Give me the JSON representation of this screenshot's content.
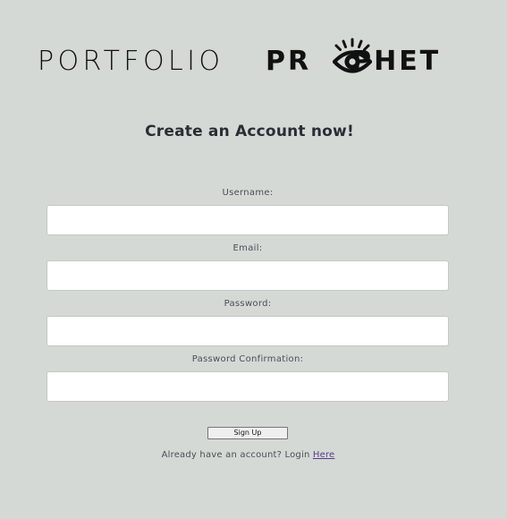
{
  "brand": {
    "name_light": "PORTFOLIO",
    "name_bold": "PR",
    "name_bold_after": "PHET",
    "icon": "eye-icon"
  },
  "page": {
    "heading": "Create an Account now!"
  },
  "form": {
    "username": {
      "label": "Username:",
      "value": "",
      "placeholder": ""
    },
    "email": {
      "label": "Email:",
      "value": "",
      "placeholder": ""
    },
    "password": {
      "label": "Password:",
      "value": "",
      "placeholder": ""
    },
    "password_confirmation": {
      "label": "Password Confirmation:",
      "value": "",
      "placeholder": ""
    },
    "submit_label": "Sign Up"
  },
  "footer": {
    "prompt": "Already have an account? Login ",
    "link_text": "Here"
  }
}
